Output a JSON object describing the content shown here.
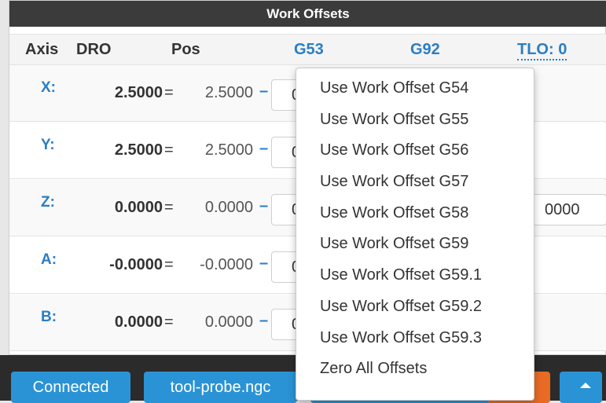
{
  "panel_title": "Work Offsets",
  "headers": {
    "axis": "Axis",
    "dro": "DRO",
    "pos": "Pos",
    "g53": "G53",
    "g92": "G92",
    "tlo": "TLO: 0"
  },
  "rows": [
    {
      "axis": "X:",
      "dro": "2.5000",
      "eq": "=",
      "pos": "2.5000",
      "minus": "–",
      "g53": "0."
    },
    {
      "axis": "Y:",
      "dro": "2.5000",
      "eq": "=",
      "pos": "2.5000",
      "minus": "–",
      "g53": "0."
    },
    {
      "axis": "Z:",
      "dro": "0.0000",
      "eq": "=",
      "pos": "0.0000",
      "minus": "–",
      "g53": "0.",
      "g92": "0000"
    },
    {
      "axis": "A:",
      "dro": "-0.0000",
      "eq": "=",
      "pos": "-0.0000",
      "minus": "–",
      "g53": "0."
    },
    {
      "axis": "B:",
      "dro": "0.0000",
      "eq": "=",
      "pos": "0.0000",
      "minus": "–",
      "g53": "0."
    }
  ],
  "dropdown": {
    "items": [
      "Use Work Offset G54",
      "Use Work Offset G55",
      "Use Work Offset G56",
      "Use Work Offset G57",
      "Use Work Offset G58",
      "Use Work Offset G59",
      "Use Work Offset G59.1",
      "Use Work Offset G59.2",
      "Use Work Offset G59.3",
      "Zero All Offsets"
    ]
  },
  "bottom_bar": {
    "connected_label": "Connected",
    "file_label": "tool-probe.ngc"
  },
  "colors": {
    "accent": "#2a7ec3",
    "button_blue": "#2a93d5",
    "button_orange": "#e86b24",
    "title_bar": "#3b3b3b"
  }
}
